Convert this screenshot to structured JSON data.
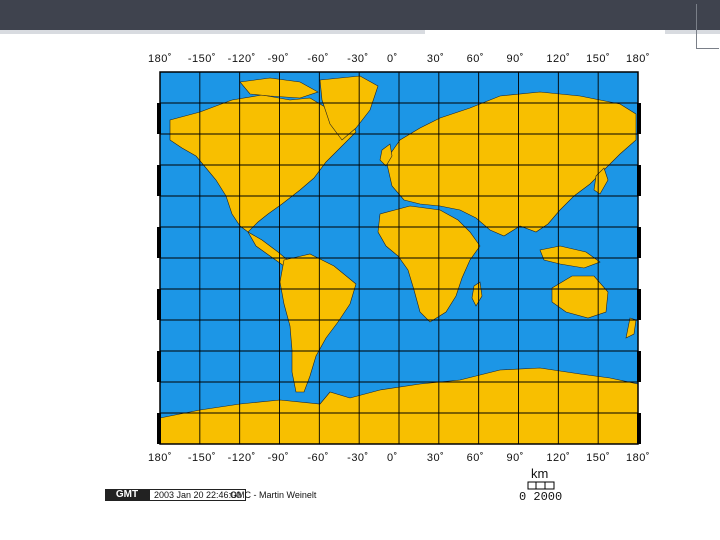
{
  "map": {
    "title": "",
    "top_labels": [
      "180˚",
      "-150˚",
      "-120˚",
      "-90˚",
      "-60˚",
      "-30˚",
      "0˚",
      "30˚",
      "60˚",
      "90˚",
      "120˚",
      "150˚",
      "180˚"
    ],
    "bottom_labels": [
      "180˚",
      "-150˚",
      "-120˚",
      "-90˚",
      "-60˚",
      "-30˚",
      "0˚",
      "30˚",
      "60˚",
      "90˚",
      "120˚",
      "150˚",
      "180˚"
    ],
    "projection": "Mercator",
    "grid": true,
    "colors": {
      "ocean": "#1c96e6",
      "land": "#f8bf00",
      "border": "#d12a2a",
      "grid": "#000000"
    }
  },
  "scale_bar": {
    "unit": "km",
    "ticks": "0 2000"
  },
  "footer": {
    "logo": "GMT",
    "timestamp": "2003 Jan 20 22:46:00",
    "credit": "GMC - Martin Weinelt"
  }
}
